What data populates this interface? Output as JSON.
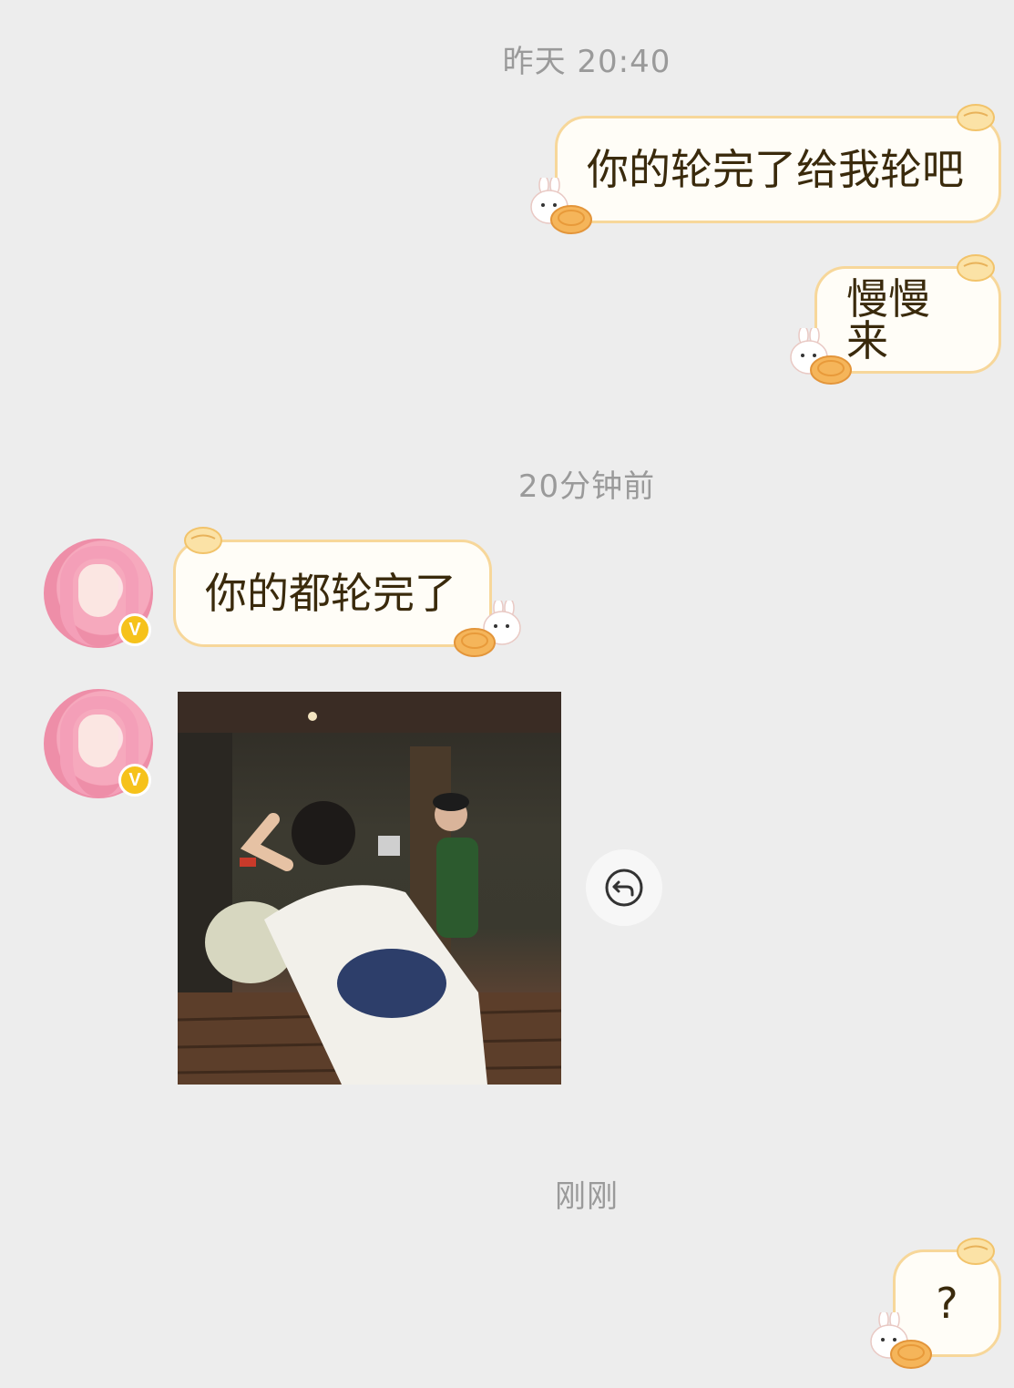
{
  "timestamps": {
    "t1": "昨天 20:40",
    "t2": "20分钟前",
    "t3": "刚刚"
  },
  "messages": {
    "m1": "你的轮完了给我轮吧",
    "m2": "慢慢来",
    "m3": "你的都轮完了",
    "m5": "?"
  },
  "colors": {
    "background": "#ededed",
    "bubble_border": "#f7d79a",
    "bubble_fill": "#fffdf7",
    "timestamp": "#9a9a9a",
    "badge": "#f6c21b"
  },
  "icons": {
    "reply": "reply-arrow-icon",
    "verified": "verified-v-badge-icon"
  },
  "badge": {
    "letter": "V"
  }
}
